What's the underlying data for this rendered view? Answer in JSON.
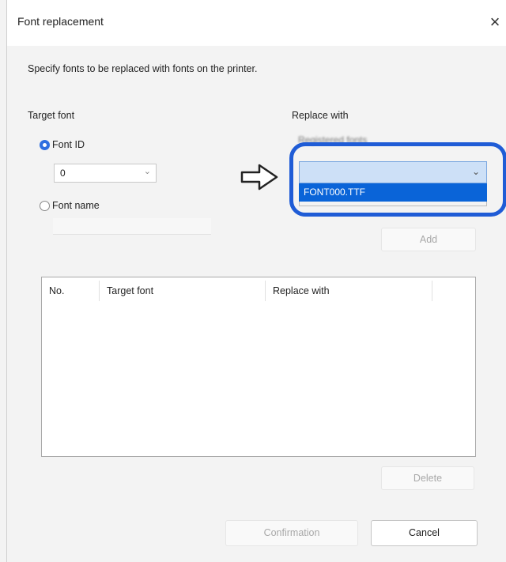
{
  "dialog": {
    "title": "Font replacement",
    "close_glyph": "×",
    "description": "Specify fonts to be replaced with fonts on the printer."
  },
  "target_font": {
    "label": "Target font",
    "font_id_label": "Font ID",
    "font_id_selected": true,
    "font_id_value": "0",
    "font_name_label": "Font name",
    "font_name_selected": false
  },
  "replace_with": {
    "label": "Replace with",
    "registered_fonts_label": "Registered fonts",
    "dropdown_value": "",
    "options": [
      "FONT000.TTF"
    ],
    "highlighted_option": "FONT000.TTF"
  },
  "buttons": {
    "add": "Add",
    "delete": "Delete",
    "confirmation": "Confirmation",
    "cancel": "Cancel"
  },
  "table": {
    "columns": [
      "No.",
      "Target font",
      "Replace with"
    ],
    "rows": []
  },
  "colors": {
    "accent": "#2f6fe0",
    "callout": "#1f5cd6",
    "selection": "#0a64d8"
  },
  "icons": {
    "arrow": "right-arrow-outline-icon",
    "close": "close-icon",
    "chevron": "chevron-down-icon"
  }
}
